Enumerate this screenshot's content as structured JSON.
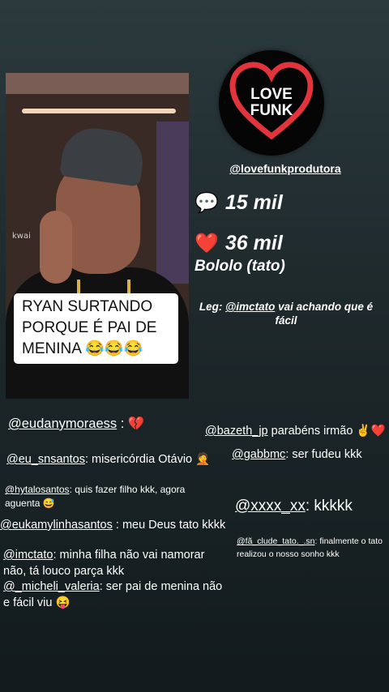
{
  "post": {
    "caption": "RYAN SURTANDO\nPORQUE É PAI DE\nMENINA 😂😂😂",
    "watermark": "kwai"
  },
  "profile": {
    "logo_line1": "LOVE",
    "logo_line2": "FUNK",
    "handle": "@lovefunkprodutora"
  },
  "stats": {
    "comments_icon": "💬",
    "comments": "15 mil",
    "likes_icon": "❤️",
    "likes": "36 mil"
  },
  "music": "Bololo (tato)",
  "legend": {
    "prefix": "Leg: ",
    "user": "@imctato",
    "text": " vai achando que é fácil"
  },
  "comments": [
    {
      "user": "@eudanymoraess",
      "text": " : 💔"
    },
    {
      "user": "@bazeth_jp",
      "text": " parabéns irmão ✌️❤️"
    },
    {
      "user": "@eu_snsantos",
      "text": ": misericórdia Otávio 🤦"
    },
    {
      "user": "@gabbmc",
      "text": ": ser  fudeu kkk"
    },
    {
      "user": "@hytalosantos",
      "text": ": quis fazer filho kkk, agora aguenta 😅"
    },
    {
      "user": "@xxxx_xx",
      "text": ": kkkkk"
    },
    {
      "user": "@eukamylinhasantos",
      "text": " : meu Deus tato kkkk"
    },
    {
      "user": "@fã_clude_tato._.sn",
      "text": ": finalmente o tato realizou o nosso sonho kkk"
    },
    {
      "user": "@imctato",
      "text": ": minha filha não vai namorar não, tá louco parça kkk"
    },
    {
      "user": "@_micheli_valeria",
      "text": ": ser pai de menina não e fácil viu 😝"
    }
  ],
  "colors": {
    "heart": "#e3343b",
    "background_top": "#2b3a3d",
    "background_bottom": "#121a1d"
  }
}
